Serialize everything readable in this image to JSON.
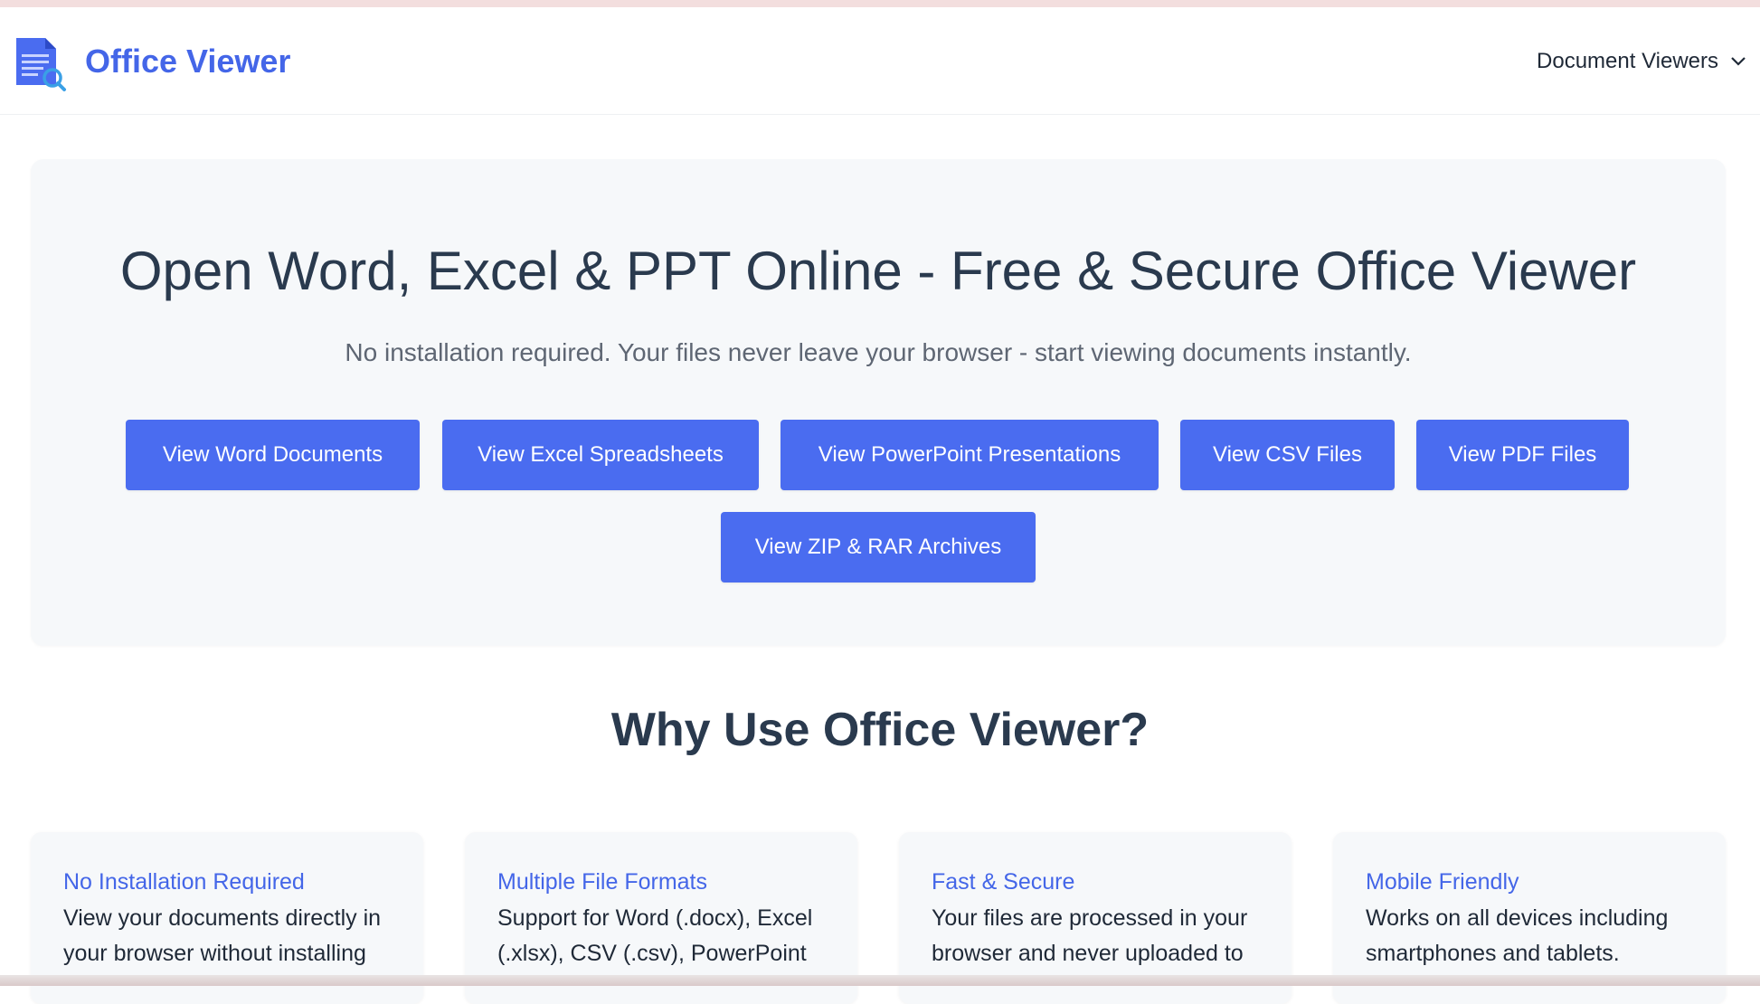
{
  "header": {
    "brand": "Office Viewer",
    "logo_icon": "document-search-icon",
    "nav_label": "Document Viewers",
    "nav_icon": "chevron-down-icon"
  },
  "hero": {
    "title": "Open Word, Excel & PPT Online - Free & Secure Office Viewer",
    "subtitle": "No installation required. Your files never leave your browser - start viewing documents instantly.",
    "buttons": [
      "View Word Documents",
      "View Excel Spreadsheets",
      "View PowerPoint Presentations",
      "View CSV Files",
      "View PDF Files",
      "View ZIP & RAR Archives"
    ]
  },
  "why": {
    "title": "Why Use Office Viewer?",
    "cards": [
      {
        "title": "No Installation Required",
        "body": "View your documents directly in your browser without installing"
      },
      {
        "title": "Multiple File Formats",
        "body": "Support for Word (.docx), Excel (.xlsx), CSV (.csv), PowerPoint"
      },
      {
        "title": "Fast & Secure",
        "body": "Your files are processed in your browser and never uploaded to"
      },
      {
        "title": "Mobile Friendly",
        "body": "Works on all devices including smartphones and tablets."
      }
    ]
  },
  "colors": {
    "accent": "#4a6cf0",
    "brand": "#4466e8",
    "heading": "#2a3a4e",
    "panel": "#f6f8fa"
  }
}
